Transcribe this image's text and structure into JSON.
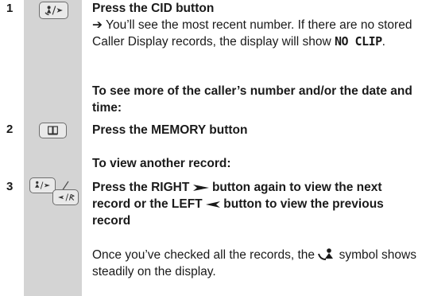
{
  "steps": [
    {
      "number": "1",
      "key_icon": "cid-key-icon",
      "heading": "Press the CID button",
      "arrow": "➔",
      "result_text": "You’ll see the most recent number. If there are no stored Caller Display records, the display will show",
      "display_text": "NO CLIP",
      "result_end": ".",
      "subheading": "To see more of the caller’s number and/or the date and time:"
    },
    {
      "number": "2",
      "key_icon": "memory-book-key-icon",
      "heading": "Press the MEMORY button",
      "subheading": "To view another record:"
    },
    {
      "number": "3",
      "key_icon": "right-left-keys-icon",
      "heading_part1": "Press the RIGHT",
      "heading_part2": "button again to view the next record or the LEFT",
      "heading_part3": "button to view the previous record",
      "note_part1": "Once you’ve checked all the records, the",
      "note_part2": "symbol shows steadily on the display."
    }
  ],
  "colors": {
    "sidebar": "#d4d4d4",
    "key_fill": "#e9e9e9",
    "key_border": "#6e6e6e",
    "text": "#1a1a1a"
  }
}
